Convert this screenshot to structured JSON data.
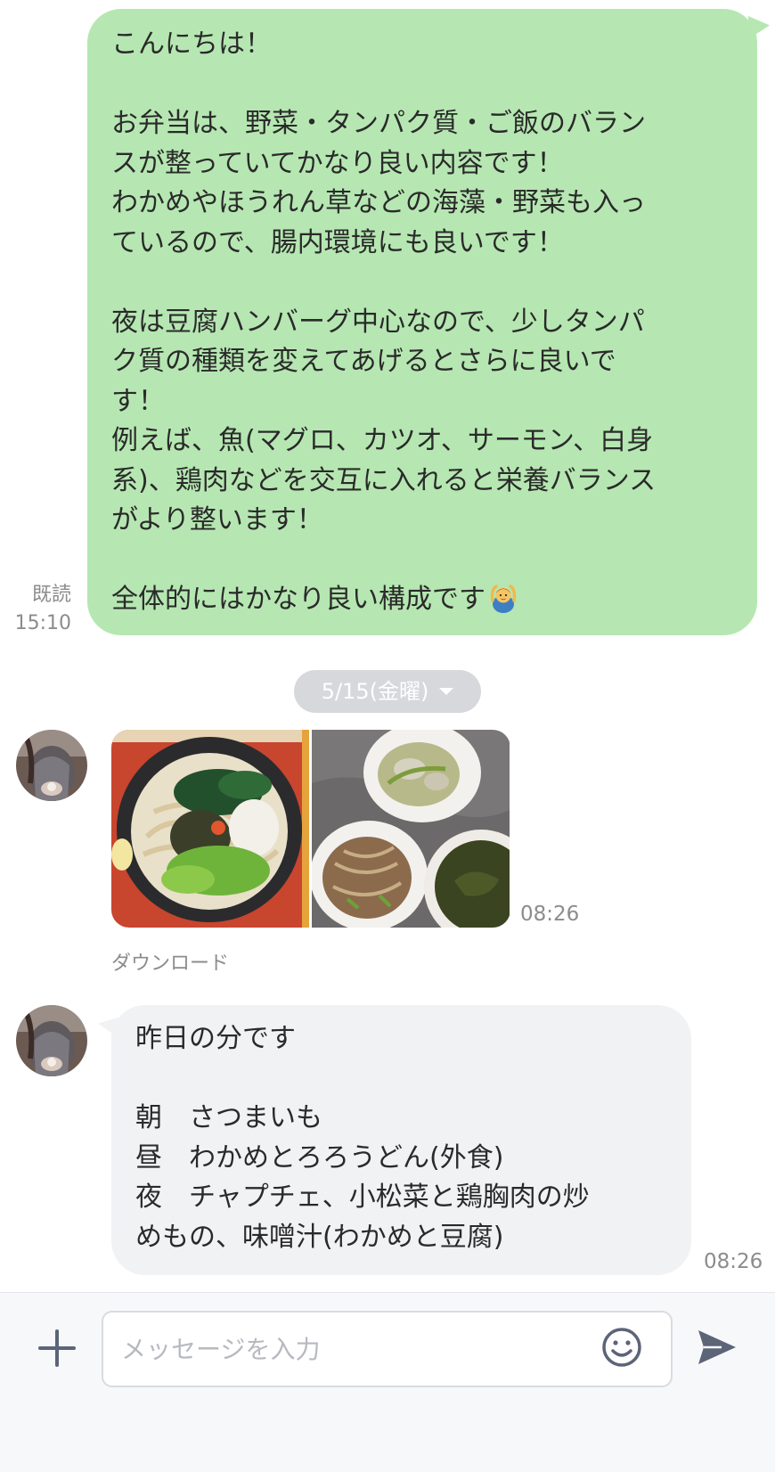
{
  "outgoing_message": {
    "lines": [
      "こんにちは！",
      "",
      "お弁当は、野菜・タンパク質・ご飯のバラン",
      "スが整っていてかなり良い内容です！",
      "わかめやほうれん草などの海藻・野菜も入っ",
      "ているので、腸内環境にも良いです！",
      "",
      "夜は豆腐ハンバーグ中心なので、少しタンパ",
      "ク質の種類を変えてあげるとさらに良いで",
      "す！",
      "例えば、魚(マグロ、カツオ、サーモン、白身",
      "系)、鶏肉などを交互に入れると栄養バランス",
      "がより整います！",
      "",
      "全体的にはかなり良い構成です"
    ],
    "trailing_emoji": "person-gesturing-ok-emoji",
    "read_label": "既読",
    "time": "15:10"
  },
  "date_divider": {
    "label": "5/15(金曜)"
  },
  "photo_message": {
    "photos": [
      "udon-bowl-photo",
      "side-dishes-photo"
    ],
    "time": "08:26",
    "download_label": "ダウンロード"
  },
  "incoming_message": {
    "lines": [
      "昨日の分です",
      "",
      "朝　さつまいも",
      "昼　わかめとろろうどん(外食)",
      "夜　チャプチェ、小松菜と鶏胸肉の炒",
      "めもの、味噌汁(わかめと豆腐)"
    ],
    "time": "08:26"
  },
  "input_bar": {
    "placeholder": "メッセージを入力",
    "icons": [
      "plus-icon",
      "smiley-icon",
      "send-icon"
    ]
  },
  "colors": {
    "outgoing_bubble": "#b6e7b2",
    "incoming_bubble": "#f1f2f4",
    "date_pill": "#d6d8db",
    "meta_text": "#8c8c8c",
    "icon_color": "#5c6478"
  }
}
